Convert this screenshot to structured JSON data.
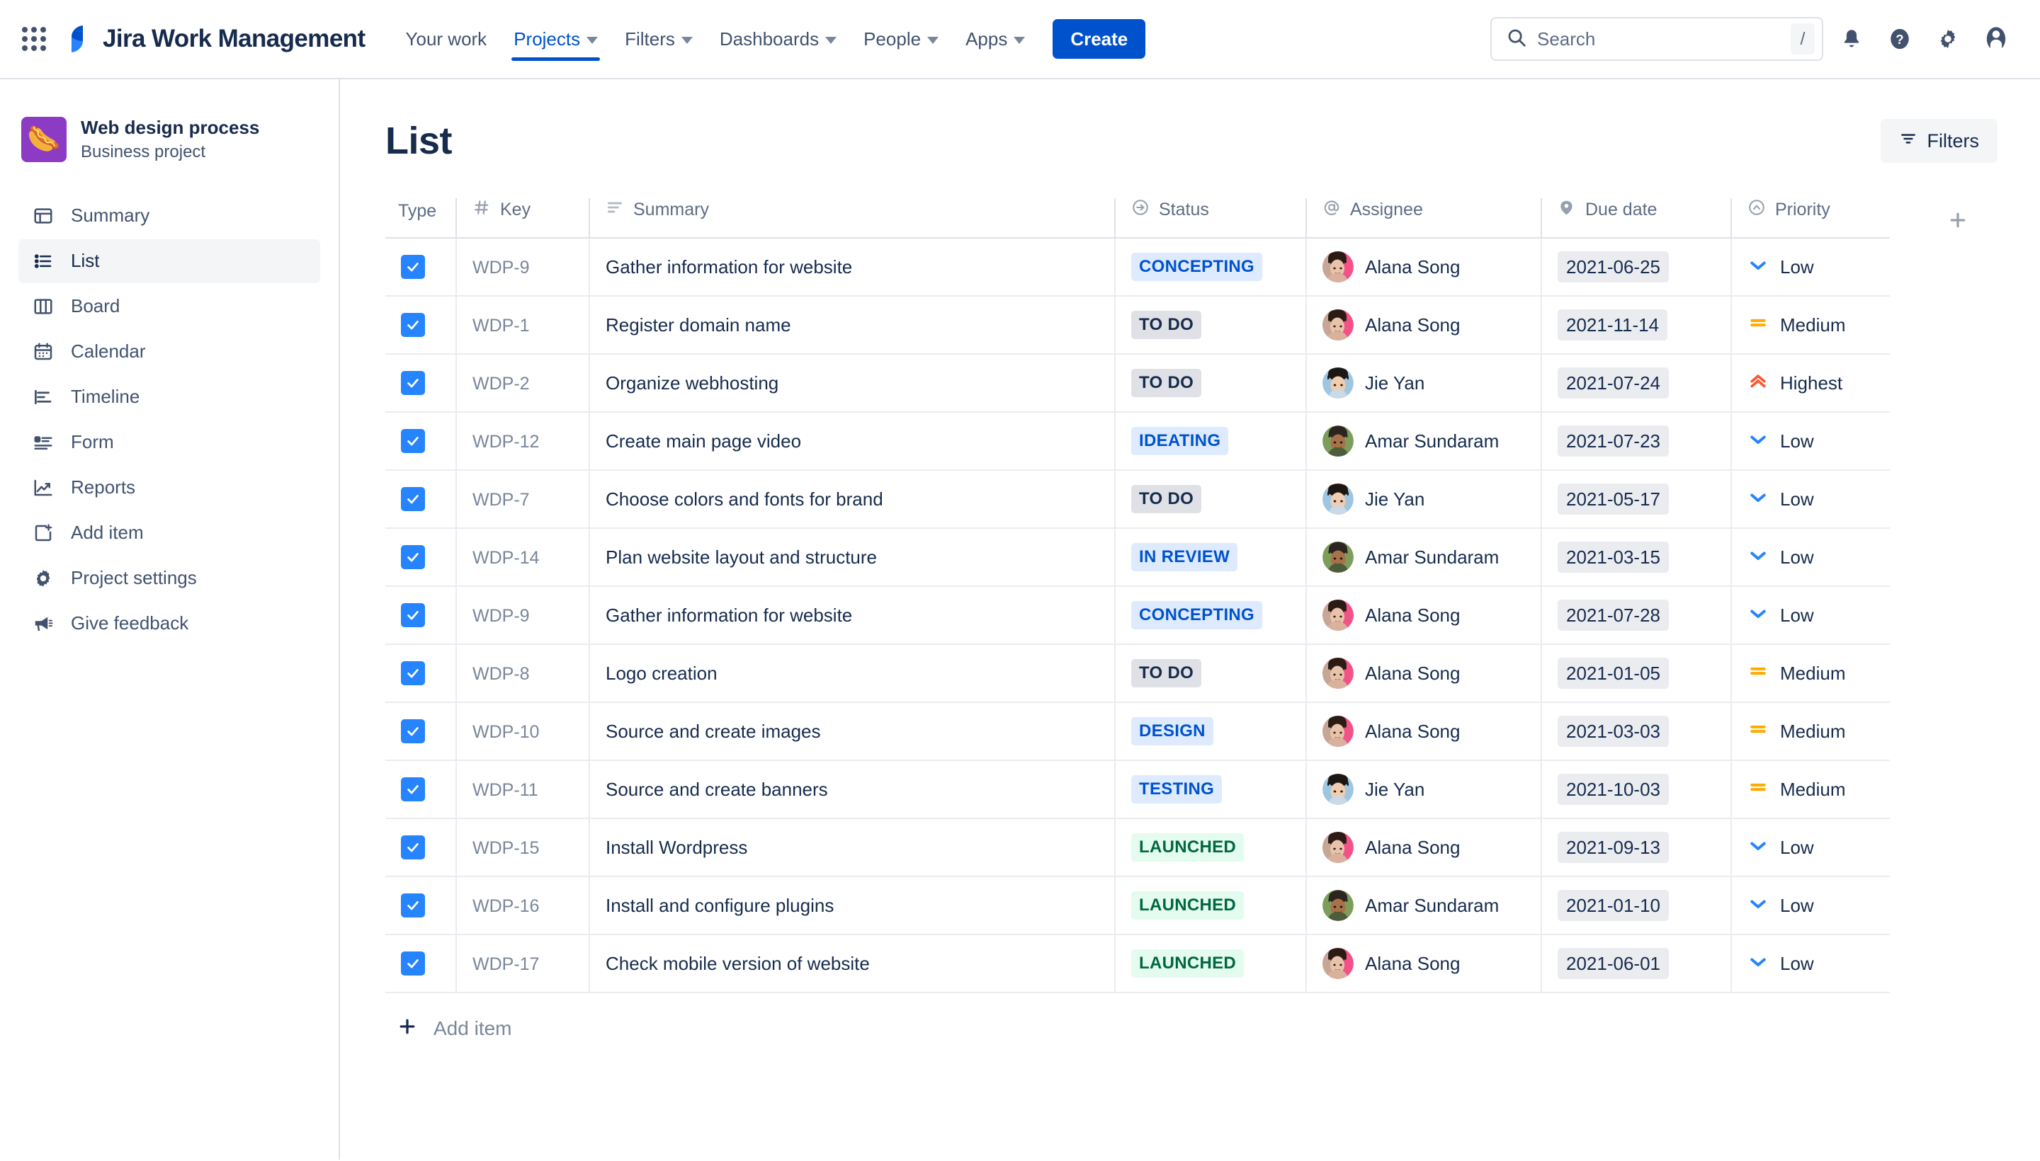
{
  "topnav": {
    "apps_icon": "apps-grid-icon",
    "brand": "Jira Work Management",
    "links": [
      {
        "label": "Your work",
        "has_caret": false,
        "active": false
      },
      {
        "label": "Projects",
        "has_caret": true,
        "active": true
      },
      {
        "label": "Filters",
        "has_caret": true,
        "active": false
      },
      {
        "label": "Dashboards",
        "has_caret": true,
        "active": false
      },
      {
        "label": "People",
        "has_caret": true,
        "active": false
      },
      {
        "label": "Apps",
        "has_caret": true,
        "active": false
      }
    ],
    "create_label": "Create",
    "search": {
      "placeholder": "Search",
      "value": "",
      "shortcut": "/"
    },
    "icons": [
      "notifications-bell-icon",
      "help-question-icon",
      "settings-gear-icon",
      "account-avatar-icon"
    ]
  },
  "sidebar": {
    "project": {
      "name": "Web design process",
      "type": "Business project",
      "emoji": "🌭"
    },
    "items": [
      {
        "label": "Summary",
        "icon": "summary-icon",
        "selected": false
      },
      {
        "label": "List",
        "icon": "list-icon",
        "selected": true
      },
      {
        "label": "Board",
        "icon": "board-icon",
        "selected": false
      },
      {
        "label": "Calendar",
        "icon": "calendar-icon",
        "selected": false
      },
      {
        "label": "Timeline",
        "icon": "timeline-icon",
        "selected": false
      },
      {
        "label": "Form",
        "icon": "form-icon",
        "selected": false
      },
      {
        "label": "Reports",
        "icon": "reports-icon",
        "selected": false
      },
      {
        "label": "Add item",
        "icon": "add-item-icon",
        "selected": false
      },
      {
        "label": "Project settings",
        "icon": "gear-icon",
        "selected": false
      },
      {
        "label": "Give feedback",
        "icon": "megaphone-icon",
        "selected": false
      }
    ]
  },
  "main": {
    "page_title": "List",
    "filters_label": "Filters",
    "add_item_label": "Add item",
    "add_column_icon": "plus-icon",
    "columns": [
      {
        "label": "Type",
        "icon": ""
      },
      {
        "label": "Key",
        "icon": "hash-icon"
      },
      {
        "label": "Summary",
        "icon": "text-lines-icon"
      },
      {
        "label": "Status",
        "icon": "arrow-circle-icon"
      },
      {
        "label": "Assignee",
        "icon": "at-icon"
      },
      {
        "label": "Due date",
        "icon": "tag-icon"
      },
      {
        "label": "Priority",
        "icon": "chevron-circle-icon"
      }
    ],
    "rows": [
      {
        "type": "task",
        "key": "WDP-9",
        "summary": "Gather information for website",
        "status": "CONCEPTING",
        "status_tone": "blue",
        "assignee": "Alana Song",
        "avatar": "alana",
        "due": "2021-06-25",
        "priority": "Low",
        "priority_icon": "arrow-down-blue"
      },
      {
        "type": "task",
        "key": "WDP-1",
        "summary": "Register domain name",
        "status": "TO DO",
        "status_tone": "gray",
        "assignee": "Alana Song",
        "avatar": "alana",
        "due": "2021-11-14",
        "priority": "Medium",
        "priority_icon": "equals-orange"
      },
      {
        "type": "task",
        "key": "WDP-2",
        "summary": "Organize webhosting",
        "status": "TO DO",
        "status_tone": "gray",
        "assignee": "Jie Yan",
        "avatar": "jie",
        "due": "2021-07-24",
        "priority": "Highest",
        "priority_icon": "double-up-red"
      },
      {
        "type": "task",
        "key": "WDP-12",
        "summary": "Create main page video",
        "status": "IDEATING",
        "status_tone": "blue",
        "assignee": "Amar Sundaram",
        "avatar": "amar",
        "due": "2021-07-23",
        "priority": "Low",
        "priority_icon": "arrow-down-blue"
      },
      {
        "type": "task",
        "key": "WDP-7",
        "summary": "Choose colors and fonts for brand",
        "status": "TO DO",
        "status_tone": "gray",
        "assignee": "Jie Yan",
        "avatar": "jie",
        "due": "2021-05-17",
        "priority": "Low",
        "priority_icon": "arrow-down-blue"
      },
      {
        "type": "task",
        "key": "WDP-14",
        "summary": "Plan website layout and structure",
        "status": "IN REVIEW",
        "status_tone": "blue",
        "assignee": "Amar Sundaram",
        "avatar": "amar",
        "due": "2021-03-15",
        "priority": "Low",
        "priority_icon": "arrow-down-blue"
      },
      {
        "type": "task",
        "key": "WDP-9",
        "summary": "Gather information for website",
        "status": "CONCEPTING",
        "status_tone": "blue",
        "assignee": "Alana Song",
        "avatar": "alana",
        "due": "2021-07-28",
        "priority": "Low",
        "priority_icon": "arrow-down-blue"
      },
      {
        "type": "task",
        "key": "WDP-8",
        "summary": "Logo creation",
        "status": "TO DO",
        "status_tone": "gray",
        "assignee": "Alana Song",
        "avatar": "alana",
        "due": "2021-01-05",
        "priority": "Medium",
        "priority_icon": "equals-orange"
      },
      {
        "type": "task",
        "key": "WDP-10",
        "summary": "Source and create images",
        "status": "DESIGN",
        "status_tone": "blue",
        "assignee": "Alana Song",
        "avatar": "alana",
        "due": "2021-03-03",
        "priority": "Medium",
        "priority_icon": "equals-orange"
      },
      {
        "type": "task",
        "key": "WDP-11",
        "summary": "Source and create banners",
        "status": "TESTING",
        "status_tone": "blue",
        "assignee": "Jie Yan",
        "avatar": "jie",
        "due": "2021-10-03",
        "priority": "Medium",
        "priority_icon": "equals-orange"
      },
      {
        "type": "task",
        "key": "WDP-15",
        "summary": "Install Wordpress",
        "status": "LAUNCHED",
        "status_tone": "green",
        "assignee": "Alana Song",
        "avatar": "alana",
        "due": "2021-09-13",
        "priority": "Low",
        "priority_icon": "arrow-down-blue"
      },
      {
        "type": "task",
        "key": "WDP-16",
        "summary": "Install and configure plugins",
        "status": "LAUNCHED",
        "status_tone": "green",
        "assignee": "Amar Sundaram",
        "avatar": "amar",
        "due": "2021-01-10",
        "priority": "Low",
        "priority_icon": "arrow-down-blue"
      },
      {
        "type": "task",
        "key": "WDP-17",
        "summary": "Check mobile version of website",
        "status": "LAUNCHED",
        "status_tone": "green",
        "assignee": "Alana Song",
        "avatar": "alana",
        "due": "2021-06-01",
        "priority": "Low",
        "priority_icon": "arrow-down-blue"
      }
    ]
  },
  "colors": {
    "brand_blue": "#0052cc",
    "accent_blue": "#2684ff",
    "text": "#172b4d",
    "subtle_text": "#5e6c84",
    "border": "#dfe1e6",
    "status_blue_bg": "#deebff",
    "status_gray_bg": "#dfe1e6",
    "status_green_bg": "#e3fcef",
    "status_green_fg": "#006644",
    "priority_low": "#2684ff",
    "priority_medium": "#ffab00",
    "priority_highest": "#ff5630",
    "project_avatar": "#8b3bc4"
  }
}
